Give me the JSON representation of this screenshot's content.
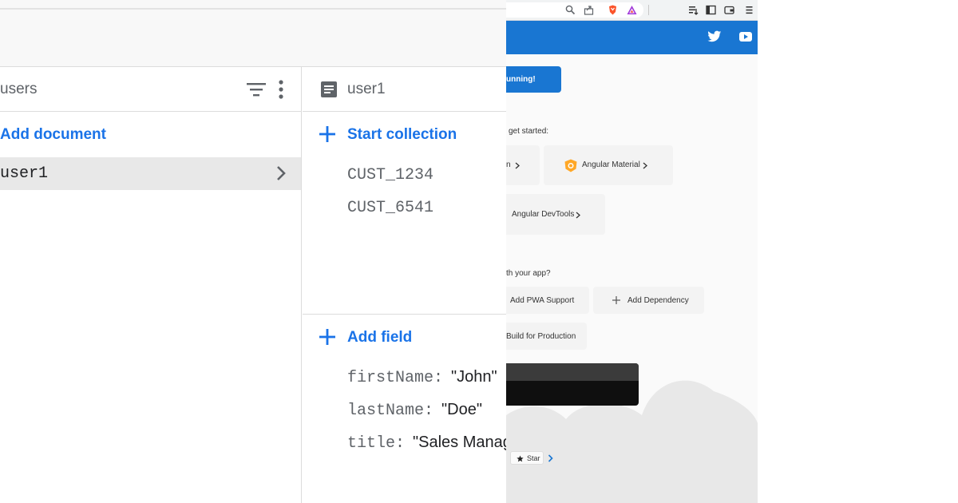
{
  "firestore": {
    "collection": {
      "title": "users",
      "add_document_label": "Add document",
      "documents": [
        {
          "id": "user1"
        }
      ]
    },
    "document": {
      "title": "user1",
      "start_collection_label": "Start collection",
      "subcollections": [
        "CUST_1234",
        "CUST_6541"
      ],
      "add_field_label": "Add field",
      "fields": [
        {
          "key": "firstName:",
          "value": "\"John\""
        },
        {
          "key": "lastName:",
          "value": "\"Doe\""
        },
        {
          "key": "title:",
          "value": "\"Sales Manage"
        }
      ]
    },
    "accent_color": "#1a73e8"
  },
  "browser": {
    "toolbar_icons": [
      "zoom-icon",
      "share-icon",
      "brave-shield-icon",
      "brave-rewards-icon",
      "reading-list-icon",
      "sidebar-icon",
      "wallet-icon",
      "menu-icon"
    ],
    "angular_page": {
      "toolbar_color": "#1976d2",
      "social_icons": [
        "twitter-icon",
        "youtube-icon"
      ],
      "running_banner": "unning!",
      "resources_heading": "get started:",
      "resources": [
        {
          "label": "n"
        },
        {
          "label": "Angular Material"
        },
        {
          "label": "Angular DevTools"
        }
      ],
      "next_steps_heading": "th your app?",
      "next_steps": [
        {
          "label": "Add PWA Support"
        },
        {
          "label": "Add Dependency"
        },
        {
          "label": "Build for Production"
        }
      ],
      "star_button": "Star"
    }
  }
}
